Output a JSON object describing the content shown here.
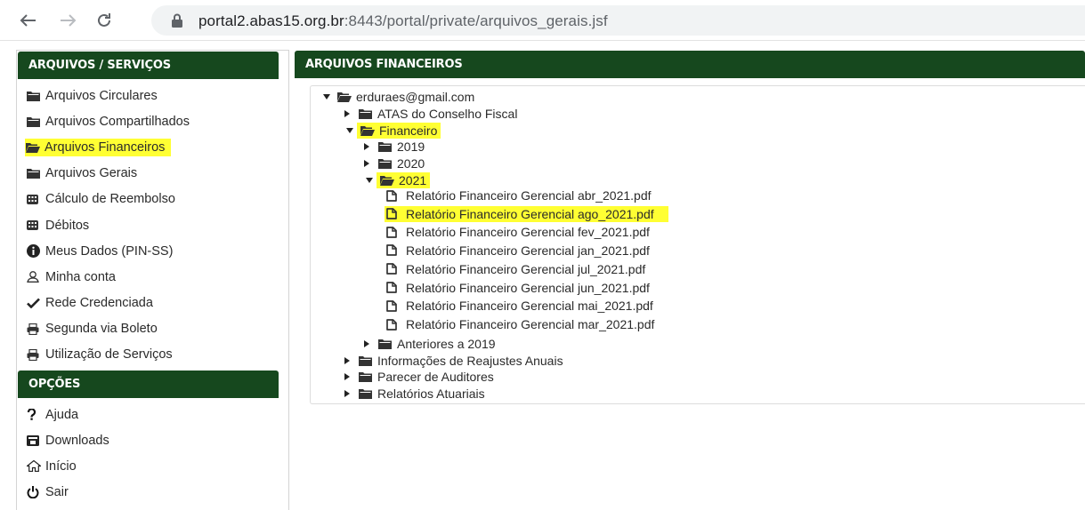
{
  "browser": {
    "url_host": "portal2.abas15.org.br",
    "url_path": ":8443/portal/private/arquivos_gerais.jsf"
  },
  "sidebar": {
    "header": "ARQUIVOS / SERVIÇOS",
    "items": [
      {
        "label": "Arquivos Circulares",
        "icon": "folder-icon"
      },
      {
        "label": "Arquivos Compartilhados",
        "icon": "folder-icon"
      },
      {
        "label": "Arquivos Financeiros",
        "icon": "folder-open-icon",
        "highlighted": true
      },
      {
        "label": "Arquivos Gerais",
        "icon": "folder-icon"
      },
      {
        "label": "Cálculo de Reembolso",
        "icon": "calculator-icon"
      },
      {
        "label": "Débitos",
        "icon": "calculator-icon"
      },
      {
        "label": "Meus Dados (PIN-SS)",
        "icon": "info-icon"
      },
      {
        "label": "Minha conta",
        "icon": "user-icon"
      },
      {
        "label": "Rede Credenciada",
        "icon": "check-icon"
      },
      {
        "label": "Segunda via Boleto",
        "icon": "print-icon"
      },
      {
        "label": "Utilização de Serviços",
        "icon": "print-icon"
      }
    ],
    "options_header": "OPÇÕES",
    "options": [
      {
        "label": "Ajuda",
        "icon": "question-icon"
      },
      {
        "label": "Downloads",
        "icon": "download-icon"
      },
      {
        "label": "Início",
        "icon": "home-icon"
      },
      {
        "label": "Sair",
        "icon": "power-icon"
      }
    ]
  },
  "main": {
    "header": "ARQUIVOS FINANCEIROS",
    "tree": [
      {
        "label": "erduraes@gmail.com",
        "state": "expanded",
        "level": 0
      },
      {
        "label": "ATAS do Conselho Fiscal",
        "state": "collapsed",
        "level": 1
      },
      {
        "label": "Financeiro",
        "state": "expanded",
        "level": 1,
        "highlighted": true
      },
      {
        "label": "2019",
        "state": "collapsed",
        "level": 2
      },
      {
        "label": "2020",
        "state": "collapsed",
        "level": 2
      },
      {
        "label": "2021",
        "state": "expanded",
        "level": 2,
        "highlighted": true
      },
      {
        "label": "Relatório Financeiro Gerencial abr_2021.pdf",
        "state": "file",
        "level": 3
      },
      {
        "label": "Relatório Financeiro Gerencial ago_2021.pdf",
        "state": "file",
        "level": 3,
        "highlighted": true
      },
      {
        "label": "Relatório Financeiro Gerencial fev_2021.pdf",
        "state": "file",
        "level": 3
      },
      {
        "label": "Relatório Financeiro Gerencial jan_2021.pdf",
        "state": "file",
        "level": 3
      },
      {
        "label": "Relatório Financeiro Gerencial jul_2021.pdf",
        "state": "file",
        "level": 3
      },
      {
        "label": "Relatório Financeiro Gerencial jun_2021.pdf",
        "state": "file",
        "level": 3
      },
      {
        "label": "Relatório Financeiro Gerencial mai_2021.pdf",
        "state": "file",
        "level": 3
      },
      {
        "label": "Relatório Financeiro Gerencial mar_2021.pdf",
        "state": "file",
        "level": 3
      },
      {
        "label": "Anteriores a 2019",
        "state": "collapsed",
        "level": 2
      },
      {
        "label": "Informações de Reajustes Anuais",
        "state": "collapsed",
        "level": 1
      },
      {
        "label": "Parecer de Auditores",
        "state": "collapsed",
        "level": 1
      },
      {
        "label": "Relatórios Atuariais",
        "state": "collapsed",
        "level": 1
      }
    ]
  },
  "colors": {
    "header_green": "#16481e",
    "highlight": "#ffff33"
  }
}
